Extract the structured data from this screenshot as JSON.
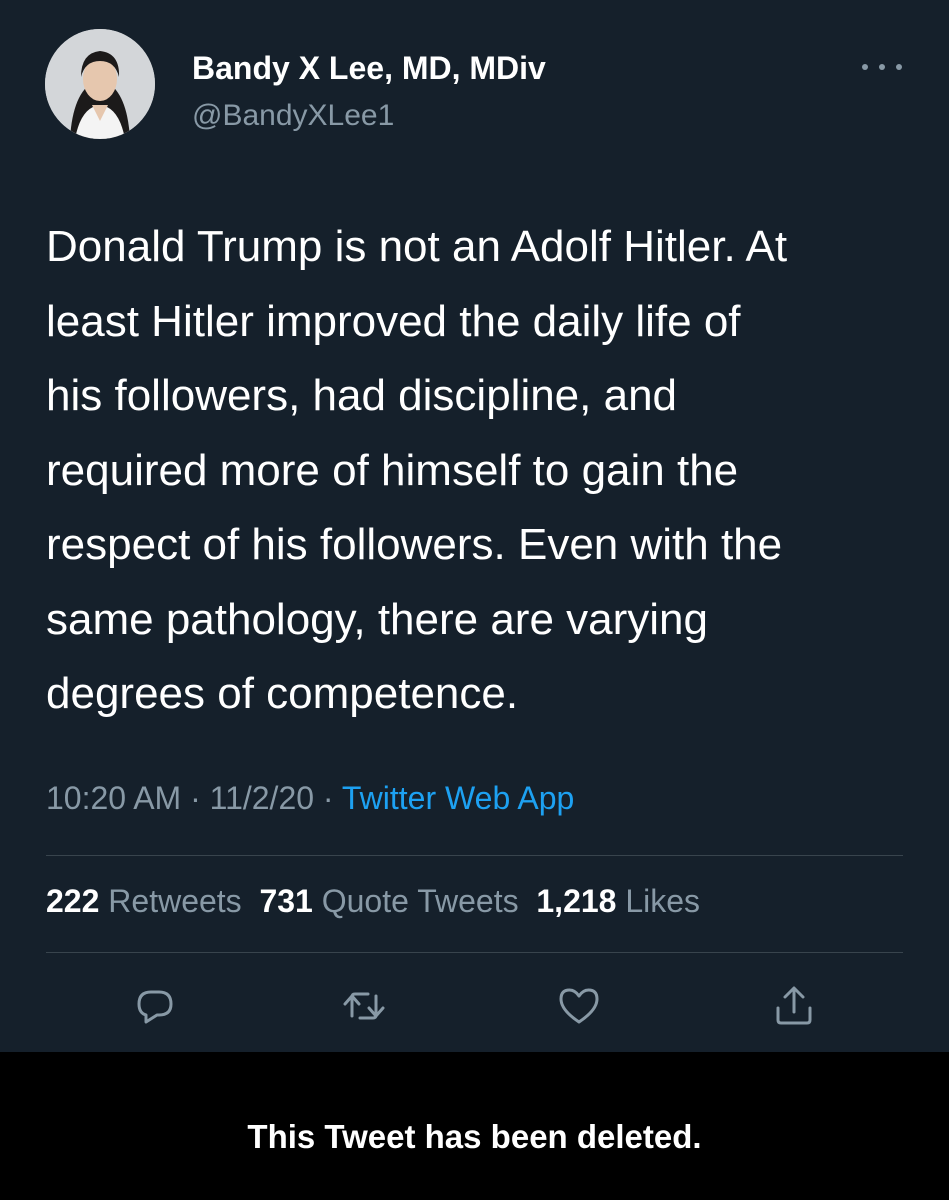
{
  "author": {
    "display_name": "Bandy X Lee, MD, MDiv",
    "handle": "@BandyXLee1"
  },
  "tweet": {
    "text": "Donald Trump is not an Adolf Hitler.  At\nleast Hitler improved the daily life of\nhis followers, had discipline, and\nrequired more of himself to gain the\nrespect of his followers.  Even with the\nsame pathology, there are varying\ndegrees of competence.",
    "time": "10:20 AM",
    "date": "11/2/20",
    "separator": "·",
    "source": "Twitter Web App"
  },
  "stats": {
    "retweets_count": "222",
    "retweets_label": "Retweets",
    "quotes_count": "731",
    "quotes_label": "Quote Tweets",
    "likes_count": "1,218",
    "likes_label": "Likes"
  },
  "actions": [
    {
      "icon": "reply-icon"
    },
    {
      "icon": "retweet-icon"
    },
    {
      "icon": "like-icon"
    },
    {
      "icon": "share-icon"
    }
  ],
  "notice": {
    "text": "This Tweet has been deleted."
  },
  "colors": {
    "background": "#15202b",
    "text": "#ffffff",
    "secondary": "#8899a6",
    "link": "#1da1f2",
    "divider": "#38444d",
    "notice_background": "#000000"
  }
}
